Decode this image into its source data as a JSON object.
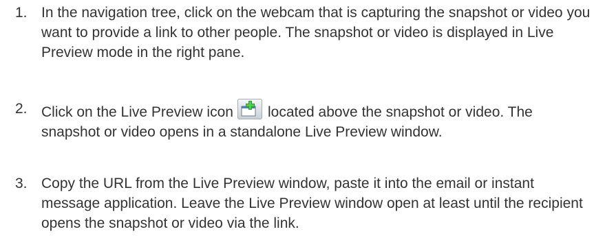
{
  "steps": [
    {
      "number": "1.",
      "text": "In the navigation tree, click on the webcam that is capturing the snapshot or video you want to provide a link to other people. The snapshot or video is displayed in Live Preview mode in the right pane."
    },
    {
      "number": "2.",
      "text_before_icon": "Click on the Live Preview icon",
      "icon": "live-preview-icon",
      "text_after_icon": "located above the snapshot or video. The snapshot or video opens in a standalone Live Preview window."
    },
    {
      "number": "3.",
      "text": "Copy the URL from the Live Preview window, paste it into the email or instant message application. Leave the Live Preview window open at least until the recipient opens the snapshot or video via the link."
    }
  ]
}
